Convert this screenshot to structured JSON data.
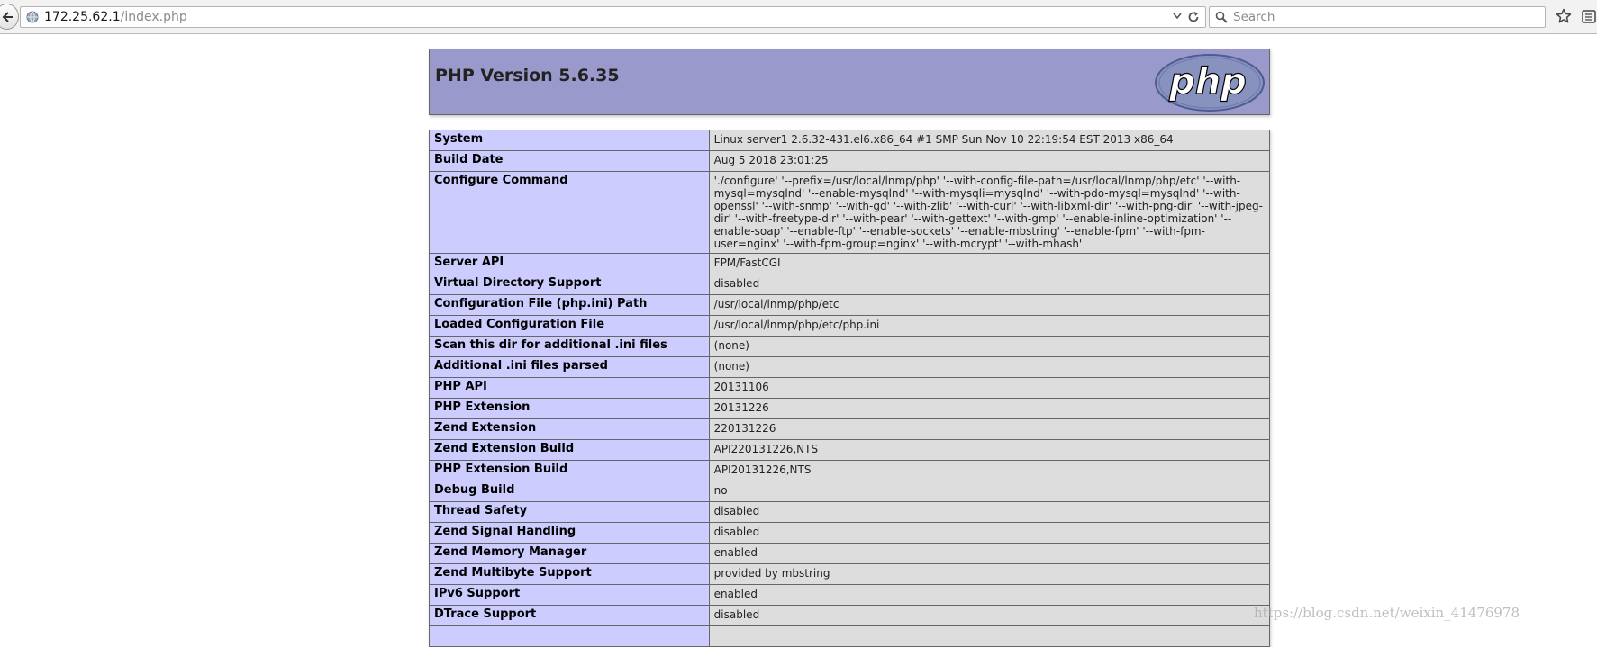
{
  "browser": {
    "url_host": "172.25.62.1",
    "url_path": "/index.php",
    "search_placeholder": "Search"
  },
  "header": {
    "title": "PHP Version 5.6.35",
    "logo_text": "php"
  },
  "rows": [
    {
      "label": "System",
      "value": "Linux server1 2.6.32-431.el6.x86_64 #1 SMP Sun Nov 10 22:19:54 EST 2013 x86_64"
    },
    {
      "label": "Build Date",
      "value": "Aug 5 2018 23:01:25"
    },
    {
      "label": "Configure Command",
      "value": "'./configure' '--prefix=/usr/local/lnmp/php' '--with-config-file-path=/usr/local/lnmp/php/etc' '--with-mysql=mysqlnd' '--enable-mysqlnd' '--with-mysqli=mysqlnd' '--with-pdo-mysql=mysqlnd' '--with-openssl' '--with-snmp' '--with-gd' '--with-zlib' '--with-curl' '--with-libxml-dir' '--with-png-dir' '--with-jpeg-dir' '--with-freetype-dir' '--with-pear' '--with-gettext' '--with-gmp' '--enable-inline-optimization' '--enable-soap' '--enable-ftp' '--enable-sockets' '--enable-mbstring' '--enable-fpm' '--with-fpm-user=nginx' '--with-fpm-group=nginx' '--with-mcrypt' '--with-mhash'"
    },
    {
      "label": "Server API",
      "value": "FPM/FastCGI"
    },
    {
      "label": "Virtual Directory Support",
      "value": "disabled"
    },
    {
      "label": "Configuration File (php.ini) Path",
      "value": "/usr/local/lnmp/php/etc"
    },
    {
      "label": "Loaded Configuration File",
      "value": "/usr/local/lnmp/php/etc/php.ini"
    },
    {
      "label": "Scan this dir for additional .ini files",
      "value": "(none)"
    },
    {
      "label": "Additional .ini files parsed",
      "value": "(none)"
    },
    {
      "label": "PHP API",
      "value": "20131106"
    },
    {
      "label": "PHP Extension",
      "value": "20131226"
    },
    {
      "label": "Zend Extension",
      "value": "220131226"
    },
    {
      "label": "Zend Extension Build",
      "value": "API220131226,NTS"
    },
    {
      "label": "PHP Extension Build",
      "value": "API20131226,NTS"
    },
    {
      "label": "Debug Build",
      "value": "no"
    },
    {
      "label": "Thread Safety",
      "value": "disabled"
    },
    {
      "label": "Zend Signal Handling",
      "value": "disabled"
    },
    {
      "label": "Zend Memory Manager",
      "value": "enabled"
    },
    {
      "label": "Zend Multibyte Support",
      "value": "provided by mbstring"
    },
    {
      "label": "IPv6 Support",
      "value": "enabled"
    },
    {
      "label": "DTrace Support",
      "value": "disabled"
    },
    {
      "label": "",
      "value": ""
    }
  ],
  "watermark": "https://blog.csdn.net/weixin_41476978"
}
